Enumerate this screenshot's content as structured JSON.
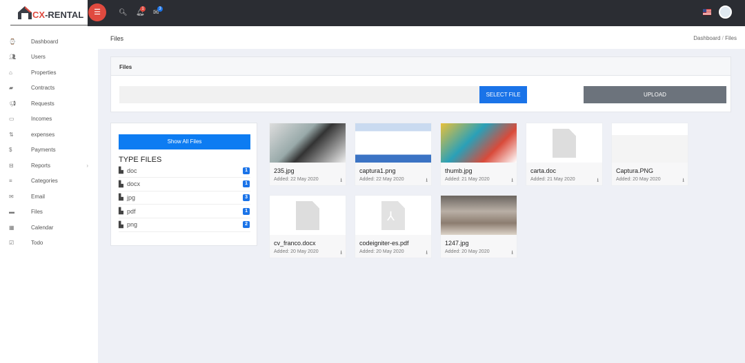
{
  "brand": {
    "name_a": "CX",
    "name_b": "-RENTAL"
  },
  "topbar": {
    "notifications_count": "1",
    "messages_count": "3"
  },
  "sidebar": {
    "items": [
      {
        "label": "Dashboard",
        "icon": "dashboard-icon"
      },
      {
        "label": "Users",
        "icon": "users-icon"
      },
      {
        "label": "Properties",
        "icon": "home-icon"
      },
      {
        "label": "Contracts",
        "icon": "book-icon"
      },
      {
        "label": "Requests",
        "icon": "bullhorn-icon"
      },
      {
        "label": "Incomes",
        "icon": "money-icon"
      },
      {
        "label": "expenses",
        "icon": "sort-icon"
      },
      {
        "label": "Payments",
        "icon": "dollar-icon"
      },
      {
        "label": "Reports",
        "icon": "inbox-icon"
      },
      {
        "label": "Categories",
        "icon": "list-icon"
      },
      {
        "label": "Email",
        "icon": "envelope-icon"
      },
      {
        "label": "Files",
        "icon": "folder-icon"
      },
      {
        "label": "Calendar",
        "icon": "calendar-icon"
      },
      {
        "label": "Todo",
        "icon": "check-square-icon"
      }
    ]
  },
  "header": {
    "title": "Files",
    "breadcrumb": [
      "Dashboard",
      "Files"
    ],
    "sep": "/"
  },
  "upload": {
    "title": "Files",
    "select_label": "SELECT FILE",
    "upload_label": "UPLOAD"
  },
  "filter": {
    "show_all": "Show All Files",
    "heading": "TYPE FILES",
    "types": [
      {
        "name": "doc",
        "count": "1"
      },
      {
        "name": "docx",
        "count": "1"
      },
      {
        "name": "jpg",
        "count": "3"
      },
      {
        "name": "pdf",
        "count": "1"
      },
      {
        "name": "png",
        "count": "2"
      }
    ]
  },
  "files": [
    {
      "name": "235.jpg",
      "date": "Added: 22 May 2020",
      "kind": "image"
    },
    {
      "name": "captura1.png",
      "date": "Added: 22 May 2020",
      "kind": "image"
    },
    {
      "name": "thumb.jpg",
      "date": "Added: 21 May 2020",
      "kind": "image"
    },
    {
      "name": "carta.doc",
      "date": "Added: 21 May 2020",
      "kind": "doc"
    },
    {
      "name": "Captura.PNG",
      "date": "Added: 20 May 2020",
      "kind": "image"
    },
    {
      "name": "cv_franco.docx",
      "date": "Added: 20 May 2020",
      "kind": "doc"
    },
    {
      "name": "codeigniter-es.pdf",
      "date": "Added: 20 May 2020",
      "kind": "pdf"
    },
    {
      "name": "1247.jpg",
      "date": "Added: 20 May 2020",
      "kind": "image"
    }
  ]
}
